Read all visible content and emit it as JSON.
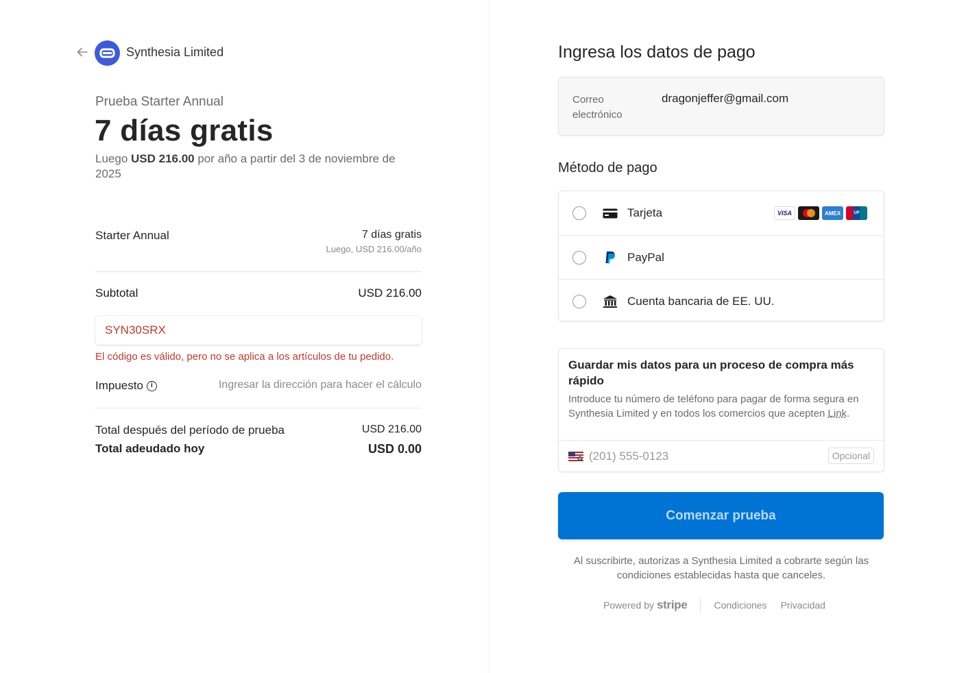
{
  "merchant": {
    "name": "Synthesia Limited",
    "back_icon": "arrow-left-icon",
    "logo_color": "#3b5bdb"
  },
  "summary": {
    "trial_label": "Prueba Starter Annual",
    "trial_headline": "7 días gratis",
    "sub_prefix": "Luego ",
    "sub_amount": "USD 216.00",
    "sub_suffix": " por año a partir del 3 de noviembre de 2025"
  },
  "line_item": {
    "name": "Starter Annual",
    "price": "7 días gratis",
    "price_sub": "Luego, USD 216.00/año"
  },
  "subtotal": {
    "label": "Subtotal",
    "value": "USD 216.00"
  },
  "coupon": {
    "code": "SYN30SRX",
    "error": "El código es válido, pero no se aplica a los artículos de tu pedido.",
    "error_color": "#c0392b"
  },
  "tax": {
    "label": "Impuesto",
    "info_icon": "i",
    "value": "Ingresar la dirección para hacer el cálculo"
  },
  "totals": {
    "after_trial_label": "Total después del período de prueba",
    "after_trial_value": "USD 216.00",
    "due_today_label": "Total adeudado hoy",
    "due_today_value": "USD 0.00"
  },
  "payment": {
    "title": "Ingresa los datos de pago",
    "email_label": "Correo electrónico",
    "email_value": "dragonjeffer@gmail.com",
    "method_title": "Método de pago",
    "methods": [
      {
        "label": "Tarjeta",
        "icon": "card-icon"
      },
      {
        "label": "PayPal",
        "icon": "paypal-icon"
      },
      {
        "label": "Cuenta bancaria de EE. UU.",
        "icon": "bank-icon"
      }
    ],
    "card_brands": [
      "VISA",
      "Mastercard",
      "AMEX",
      "UnionPay"
    ]
  },
  "link": {
    "title": "Guardar mis datos para un proceso de compra más rápido",
    "desc_text": "Introduce tu número de teléfono para pagar de forma segura en Synthesia Limited y en todos los comercios que acepten ",
    "desc_link": "Link",
    "desc_end": ".",
    "phone_placeholder": "(201) 555-0123",
    "optional_label": "Opcional",
    "flag_icon": "us-flag-icon"
  },
  "cta": {
    "label": "Comenzar prueba",
    "color": "#0074d4"
  },
  "terms": "Al suscribirte, autorizas a Synthesia Limited a cobrarte según las condiciones establecidas hasta que canceles.",
  "footer": {
    "powered_by": "Powered by",
    "stripe": "stripe",
    "terms_link": "Condiciones",
    "privacy_link": "Privacidad"
  }
}
